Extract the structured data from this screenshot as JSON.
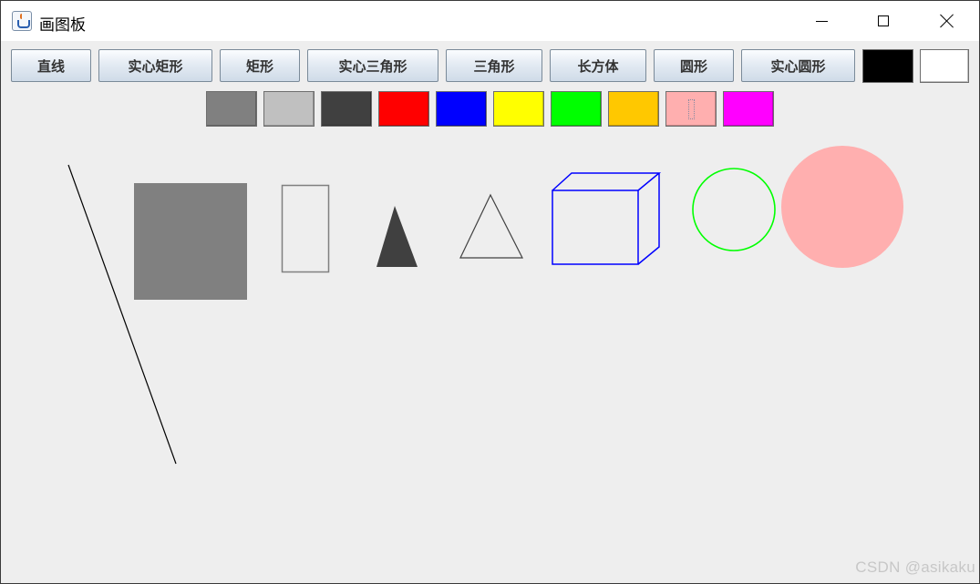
{
  "window": {
    "title": "画图板",
    "icon": "java-cup-icon",
    "controls": [
      "minimize-icon",
      "maximize-icon",
      "close-icon"
    ]
  },
  "toolbar": {
    "shape_buttons": [
      {
        "id": "line",
        "label": "直线"
      },
      {
        "id": "filled-rect",
        "label": "实心矩形"
      },
      {
        "id": "rect",
        "label": "矩形"
      },
      {
        "id": "filled-triangle",
        "label": "实心三角形"
      },
      {
        "id": "triangle",
        "label": "三角形"
      },
      {
        "id": "cuboid",
        "label": "长方体"
      },
      {
        "id": "circle",
        "label": "圆形"
      },
      {
        "id": "filled-circle",
        "label": "实心圆形"
      }
    ],
    "color_buttons_row1": [
      {
        "name": "black",
        "color": "#000000"
      },
      {
        "name": "white",
        "color": "#ffffff"
      }
    ],
    "color_buttons_row2": [
      {
        "name": "gray",
        "color": "#808080"
      },
      {
        "name": "light-gray",
        "color": "#c0c0c0"
      },
      {
        "name": "dark-gray",
        "color": "#404040"
      },
      {
        "name": "red",
        "color": "#ff0000"
      },
      {
        "name": "blue",
        "color": "#0000ff"
      },
      {
        "name": "yellow",
        "color": "#ffff00"
      },
      {
        "name": "green",
        "color": "#00ff00"
      },
      {
        "name": "orange",
        "color": "#ffc800"
      },
      {
        "name": "pink",
        "color": "#ffafaf",
        "focused": true
      },
      {
        "name": "magenta",
        "color": "#ff00ff"
      }
    ]
  },
  "canvas": {
    "background": "#eeeeee",
    "drawn_shapes": [
      {
        "type": "line",
        "color": "#000000"
      },
      {
        "type": "filled-rect",
        "color": "#808080"
      },
      {
        "type": "rect",
        "color": "#808080"
      },
      {
        "type": "filled-triangle",
        "color": "#404040"
      },
      {
        "type": "triangle",
        "color": "#404040"
      },
      {
        "type": "cuboid",
        "color": "#0000ff"
      },
      {
        "type": "circle",
        "color": "#00ff00"
      },
      {
        "type": "filled-circle",
        "color": "#ffafaf"
      }
    ]
  },
  "watermark": "CSDN @asikaku"
}
